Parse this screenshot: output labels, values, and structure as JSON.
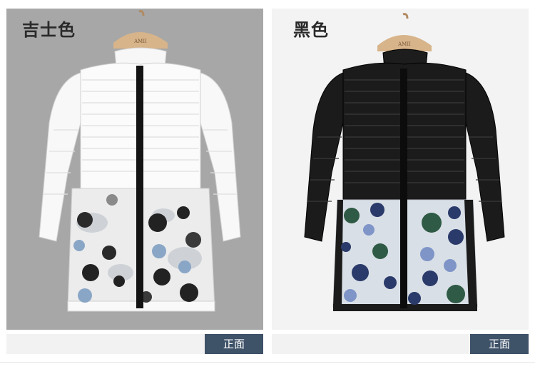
{
  "products": [
    {
      "color_label": "吉士色",
      "view_label": "正面",
      "hanger_tag": "AMII",
      "colors": {
        "background": "#a7a7a7",
        "body": "#fbfbfb",
        "quilt_line": "#dedede",
        "placket": "#141414",
        "overlay": "#e9e9e9",
        "dot_dark": "#222222",
        "dot_blue": "#8aa6c6",
        "dot_grey": "#8a8a8a"
      }
    },
    {
      "color_label": "黑色",
      "view_label": "正面",
      "hanger_tag": "AMII",
      "colors": {
        "background": "#f3f3f3",
        "body": "#1b1b1b",
        "quilt_line": "#3a3a3a",
        "placket": "#0c0c0c",
        "overlay": "#d9dfe6",
        "dot_navy": "#2a3a6a",
        "dot_green": "#2f5a45",
        "dot_blue": "#7f95c8"
      }
    }
  ]
}
